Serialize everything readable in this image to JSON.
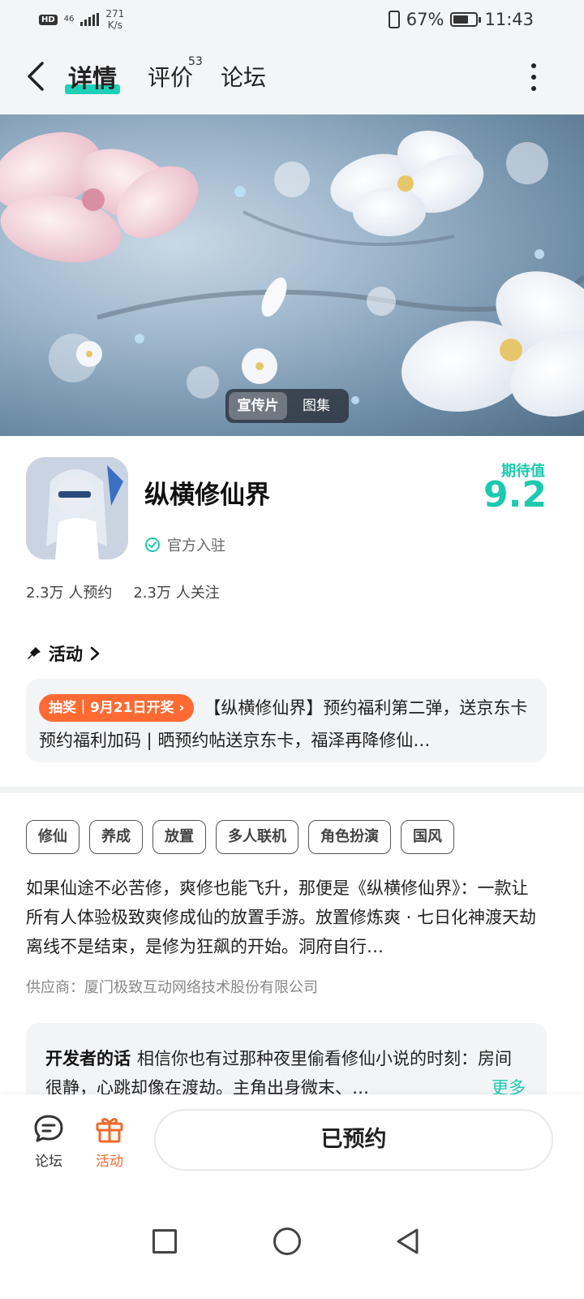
{
  "status_bar": {
    "hd": "HD",
    "network": "46",
    "speed_value": "271",
    "speed_unit": "K/s",
    "battery": "67%",
    "time": "11:43"
  },
  "nav": {
    "tabs": [
      {
        "label": "详情",
        "active": true
      },
      {
        "label": "评价",
        "badge": "53"
      },
      {
        "label": "论坛"
      }
    ]
  },
  "hero": {
    "media_options": [
      "宣传片",
      "图集"
    ],
    "active_option": "宣传片"
  },
  "app": {
    "name": "纵横修仙界",
    "verified_label": "官方入驻",
    "anticipation_label": "期待值",
    "anticipation_score": "9.2",
    "reservations": "2.3万 人预约",
    "followers": "2.3万 人关注"
  },
  "activity": {
    "heading": "活动",
    "tag": "抽奖｜9月21日开奖 ›",
    "text": "【纵横修仙界】预约福利第二弹，送京东卡 预约福利加码 | 晒预约帖送京东卡，福泽再降修仙…"
  },
  "tags": [
    "修仙",
    "养成",
    "放置",
    "多人联机",
    "角色扮演",
    "国风"
  ],
  "description": "如果仙途不必苦修，爽修也能飞升，那便是《纵横修仙界》：一款让所有人体验极致爽修成仙的放置手游。放置修炼爽 · 七日化神渡天劫 离线不是结束，是修为狂飙的开始。洞府自行…",
  "supplier": "供应商：厦门极致互动网络技术股份有限公司",
  "developer": {
    "title": "开发者的话",
    "text": "相信你也有过那种夜里偷看修仙小说的时刻：房间很静，心跳却像在渡劫。主角出身微末、…",
    "more": "更多"
  },
  "bottom_bar": {
    "forum_label": "论坛",
    "activity_label": "活动",
    "reserve_label": "已预约"
  },
  "colors": {
    "accent": "#1dc9ae",
    "orange": "#f06a2c",
    "lottery": "#ff6a33"
  }
}
